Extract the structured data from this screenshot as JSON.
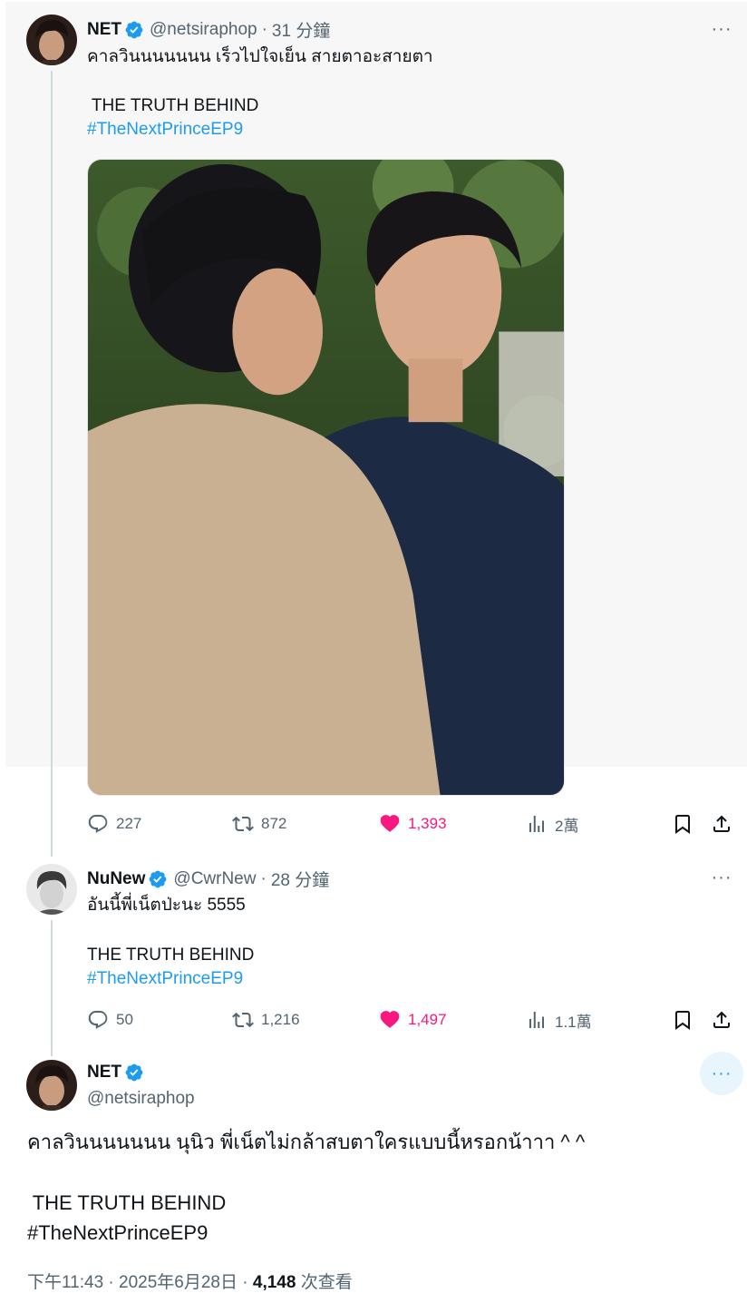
{
  "tweet1": {
    "name": "NET",
    "handle": "@netsiraphop",
    "time": "31 分鐘",
    "line1": "คาลวินนนนนนน เร็วไปใจเย็น สายตาอะสายตา",
    "line2": " THE TRUTH BEHIND",
    "hashtag": "#TheNextPrinceEP9",
    "replies": "227",
    "reposts": "872",
    "likes": "1,393",
    "views": "2萬"
  },
  "tweet2": {
    "name": "NuNew",
    "handle": "@CwrNew",
    "time": "28 分鐘",
    "line1": "อันนี้พี่เน็ตป่ะนะ 5555",
    "line2": "THE TRUTH BEHIND",
    "hashtag": "#TheNextPrinceEP9",
    "replies": "50",
    "reposts": "1,216",
    "likes": "1,497",
    "views": "1.1萬"
  },
  "tweet3": {
    "name": "NET",
    "handle": "@netsiraphop",
    "line1": "คาลวินนนนนนน นุนิว พี่เน็ตไม่กล้าสบตาใครแบบนี้หรอกน้าาา ^ ^",
    "line2": " THE TRUTH BEHIND",
    "hashtag": "#TheNextPrinceEP9",
    "timestamp": "下午11:43 · 2025年6月28日 · ",
    "views_count": "4,148",
    "views_label": " 次查看"
  },
  "separator": "·",
  "more_label": "···",
  "colors": {
    "accent": "#1d9bf0",
    "like": "#f91880",
    "muted": "#536471",
    "line": "#cfd9de"
  },
  "icons": [
    "verified-icon",
    "reply-icon",
    "repost-icon",
    "like-icon",
    "views-icon",
    "bookmark-icon",
    "share-icon",
    "more-icon"
  ]
}
